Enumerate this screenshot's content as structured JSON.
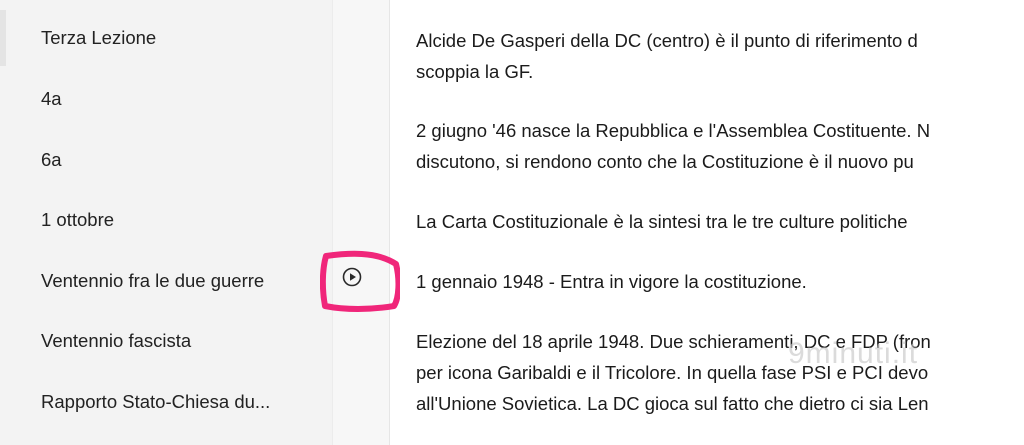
{
  "sidebar": {
    "pages": [
      {
        "label": "Terza Lezione"
      },
      {
        "label": "4a"
      },
      {
        "label": "6a"
      },
      {
        "label": "1 ottobre"
      },
      {
        "label": "Ventennio fra le due guerre"
      },
      {
        "label": "Ventennio fascista"
      },
      {
        "label": "Rapporto Stato-Chiesa du..."
      }
    ]
  },
  "audio_icon": "play-circle-icon",
  "highlight_color": "#f0267a",
  "content": {
    "paragraphs": [
      [
        "Alcide De Gasperi della DC (centro) è il punto di riferimento d",
        "scoppia la GF."
      ],
      [
        "2 giugno '46 nasce la Repubblica e l'Assemblea Costituente. N",
        "discutono, si rendono conto che la Costituzione è il nuovo pu"
      ],
      [
        "La Carta Costituzionale è la sintesi tra le tre culture politiche"
      ],
      [
        "1 gennaio 1948 - Entra in vigore la costituzione."
      ],
      [
        "Elezione del 18 aprile 1948. Due schieramenti, DC e FDP (fron",
        "per icona Garibaldi e il Tricolore. In quella fase PSI e PCI devo",
        "all'Unione Sovietica. La DC gioca sul fatto che dietro ci sia Len"
      ]
    ]
  },
  "watermark": "9minuti.it"
}
